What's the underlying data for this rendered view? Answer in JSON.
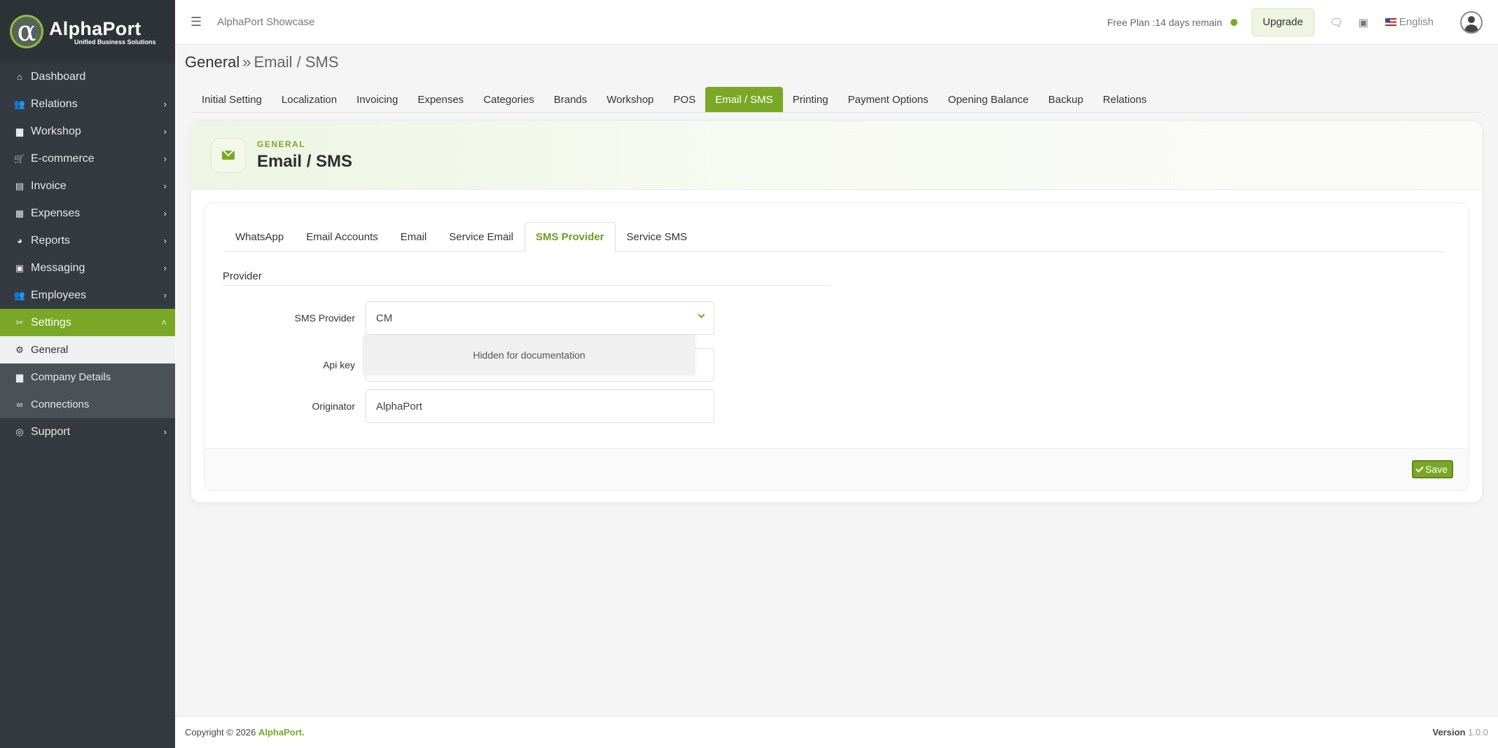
{
  "brand": {
    "name": "AlphaPort",
    "tagline": "Unified Business Solutions",
    "logo_glyph": "α"
  },
  "sidebar": {
    "items": [
      {
        "label": "Dashboard",
        "icon": "home-icon",
        "glyph": "⌂",
        "chevron": false
      },
      {
        "label": "Relations",
        "icon": "users-icon",
        "glyph": "👥",
        "chevron": true
      },
      {
        "label": "Workshop",
        "icon": "briefcase-icon",
        "glyph": "▆",
        "chevron": true
      },
      {
        "label": "E-commerce",
        "icon": "cart-icon",
        "glyph": "🛒",
        "chevron": true
      },
      {
        "label": "Invoice",
        "icon": "file-icon",
        "glyph": "▤",
        "chevron": true
      },
      {
        "label": "Expenses",
        "icon": "money-icon",
        "glyph": "▦",
        "chevron": true
      },
      {
        "label": "Reports",
        "icon": "pie-chart-icon",
        "glyph": "◕",
        "chevron": true
      },
      {
        "label": "Messaging",
        "icon": "comment-icon",
        "glyph": "▣",
        "chevron": true
      },
      {
        "label": "Employees",
        "icon": "user-group-icon",
        "glyph": "👥",
        "chevron": true
      }
    ],
    "settings": {
      "label": "Settings",
      "icon": "tools-icon",
      "glyph": "✂"
    },
    "settings_sub": [
      {
        "label": "General",
        "icon": "gear-icon",
        "glyph": "⚙"
      },
      {
        "label": "Company Details",
        "icon": "briefcase-icon",
        "glyph": "▆"
      },
      {
        "label": "Connections",
        "icon": "link-icon",
        "glyph": "∞"
      }
    ],
    "support": {
      "label": "Support",
      "icon": "lifebuoy-icon",
      "glyph": "◎"
    }
  },
  "topbar": {
    "app_title": "AlphaPort Showcase",
    "plan_text": "Free Plan :14 days remain",
    "upgrade_label": "Upgrade",
    "language": "English"
  },
  "breadcrumb": {
    "root": "General",
    "separator": "»",
    "current": "Email / SMS"
  },
  "main_tabs": [
    "Initial Setting",
    "Localization",
    "Invoicing",
    "Expenses",
    "Categories",
    "Brands",
    "Workshop",
    "POS",
    "Email / SMS",
    "Printing",
    "Payment Options",
    "Opening Balance",
    "Backup",
    "Relations"
  ],
  "main_tab_active": "Email / SMS",
  "card": {
    "kicker": "GENERAL",
    "title": "Email / SMS"
  },
  "sub_tabs": [
    "WhatsApp",
    "Email Accounts",
    "Email",
    "Service Email",
    "SMS Provider",
    "Service SMS"
  ],
  "sub_tab_active": "SMS Provider",
  "form": {
    "section_title": "Provider",
    "sms_provider_label": "SMS Provider",
    "sms_provider_value": "CM",
    "api_key_label": "Api key",
    "api_key_value": "",
    "originator_label": "Originator",
    "originator_value": "AlphaPort",
    "hidden_note": "Hidden for documentation"
  },
  "save_label": "Save",
  "footer": {
    "copyright": "Copyright © 2026",
    "brand": "AlphaPort.",
    "version_label": "Version",
    "version": "1.0.0"
  },
  "colors": {
    "accent": "#7aa826",
    "sidebar": "#343a40"
  }
}
